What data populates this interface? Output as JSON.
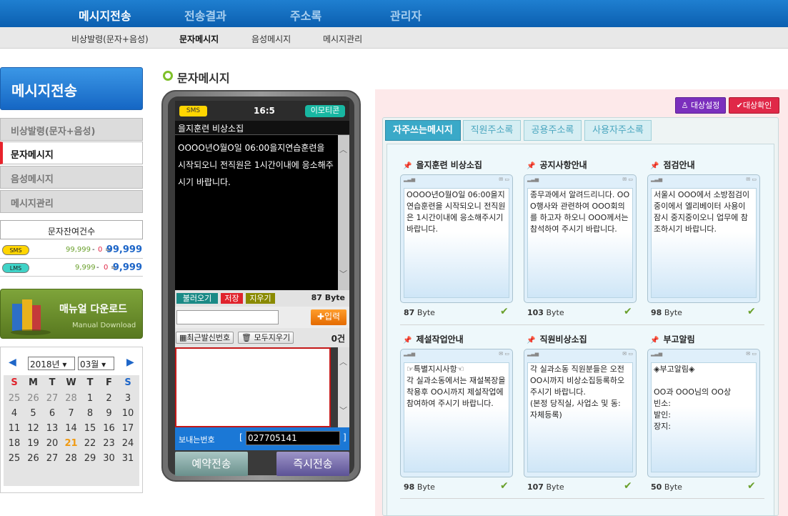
{
  "topnav": {
    "items": [
      "메시지전송",
      "전송결과",
      "주소록",
      "관리자"
    ]
  },
  "subnav": {
    "items": [
      "비상발령(문자+음성)",
      "문자메시지",
      "음성메시지",
      "메시지관리"
    ]
  },
  "sidebar": {
    "title": "메시지전송",
    "menu": [
      "비상발령(문자+음성)",
      "문자메시지",
      "음성메시지",
      "메시지관리"
    ],
    "balance_title": "문자잔여건수",
    "sms": {
      "tag": "SMS",
      "a": "99,999",
      "b": "0",
      "total": "99,999"
    },
    "lms": {
      "tag": "LMS",
      "a": "9,999",
      "b": "0",
      "total": "9,999"
    },
    "manual_title": "매뉴얼 다운로드",
    "manual_sub": "Manual Download"
  },
  "calendar": {
    "year": "2018년",
    "month": "03월",
    "weekdays": [
      "S",
      "M",
      "T",
      "W",
      "T",
      "F",
      "S"
    ],
    "weeks": [
      [
        "25",
        "26",
        "27",
        "28",
        "1",
        "2",
        "3"
      ],
      [
        "4",
        "5",
        "6",
        "7",
        "8",
        "9",
        "10"
      ],
      [
        "11",
        "12",
        "13",
        "14",
        "15",
        "16",
        "17"
      ],
      [
        "18",
        "19",
        "20",
        "21",
        "22",
        "23",
        "24"
      ],
      [
        "25",
        "26",
        "27",
        "28",
        "29",
        "30",
        "31"
      ]
    ],
    "today": "21"
  },
  "section": {
    "title": "문자메시지"
  },
  "phone": {
    "sms_tag": "SMS",
    "time": "16:5",
    "emoticon": "이모티콘",
    "subject": "을지훈련 비상소집",
    "body": "OOOO년O월O일 06:00을지연습훈련을 시작되오니 전직원은 1시간이내에 응소해주시기 바랍니다.",
    "load_btn": "불러오기",
    "save_btn": "저장",
    "clear_btn": "지우기",
    "byte": "87 Byte",
    "input_btn": "입력",
    "recent_btn": "최근발신번호",
    "clear_all_btn": "모두지우기",
    "count": "0건",
    "sender_label": "보내는번호",
    "sender_number": "027705141",
    "reserve_btn": "예약전송",
    "send_now_btn": "즉시전송"
  },
  "panel": {
    "target_setting": "대상설정",
    "target_confirm": "대상확인",
    "tabs": [
      "자주쓰는메시지",
      "직원주소록",
      "공용주소록",
      "사용자주소록"
    ]
  },
  "messages": [
    {
      "title": "을지훈련 비상소집",
      "body": "OOOO년O월O일 06:00을지연습훈련을 시작되오니 전직원은 1시간이내에 응소해주시기 바랍니다.",
      "byte": "87",
      "unit": "Byte"
    },
    {
      "title": "공지사항안내",
      "body": "종무과에서 알려드리니다. OOO행사와 관련하여 OOO회의를 하고자 하오니 OOO께서는 참석하여 주시기 바랍니다.",
      "byte": "103",
      "unit": "Byte"
    },
    {
      "title": "점검안내",
      "body": "서울시 OOO에서 소방점검이 중이에서 엘리베이터 사용이 잠시 중지중이오니 업무에 참조하시기 바랍니다.",
      "byte": "98",
      "unit": "Byte"
    },
    {
      "title": "제설작업안내",
      "body": "☞특별지시사항☜\n각 실과소동에서는 재설복장을 착용후 OO시까지 제설작업에 참여하여 주시기 바랍니다.",
      "byte": "98",
      "unit": "Byte"
    },
    {
      "title": "직원비상소집",
      "body": "각 실과소동 직원분들은 오전 OO시까지 비상소집등록하오 주시기 바랍니다.\n(본정 당직실, 사업소 및 동: 자체등록)",
      "byte": "107",
      "unit": "Byte"
    },
    {
      "title": "부고알림",
      "body": "◈부고알림◈\n\nOO과 OOO님의 OO상\n빈소:\n발인:\n장지:",
      "byte": "50",
      "unit": "Byte"
    }
  ]
}
